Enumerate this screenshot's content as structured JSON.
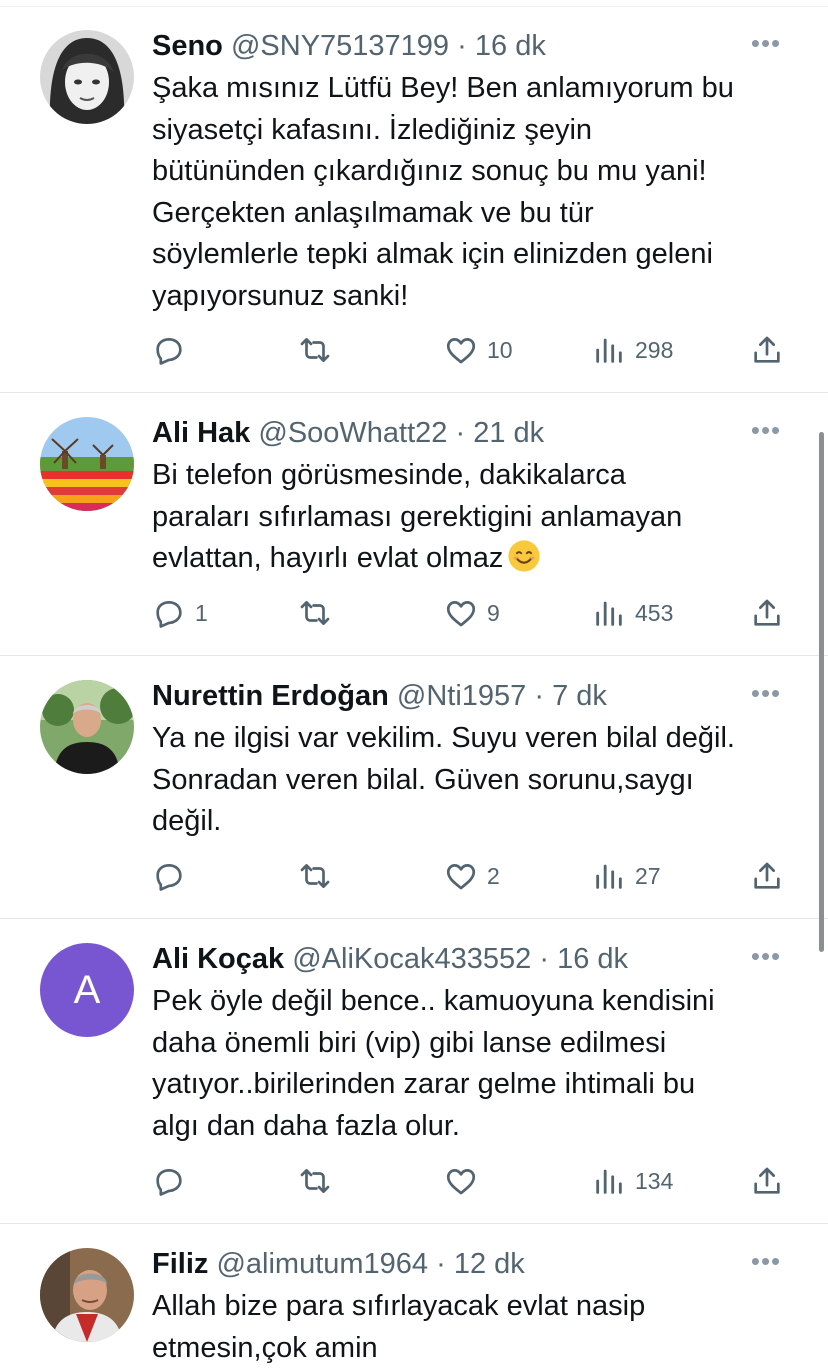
{
  "tweets": [
    {
      "name": "Seno",
      "handle": "@SNY75137199",
      "time": "16 dk",
      "lines": [
        "Şaka mısınız Lütfü Bey! Ben anlamıyorum bu",
        "siyasetçi kafasını. İzlediğiniz şeyin",
        "bütününden çıkardığınız sonuç bu mu yani!",
        "Gerçekten anlaşılmamak ve bu tür",
        "söylemlerle tepki almak için elinizden geleni",
        "yapıyorsunuz sanki!"
      ],
      "replies": "",
      "likes": "10",
      "views": "298"
    },
    {
      "name": "Ali Hak",
      "handle": "@SooWhatt22",
      "time": "21 dk",
      "lines": [
        "Bi telefon görüsmesinde, dakikalarca",
        "paraları sıfırlaması gerektigini anlamayan",
        "evlattan, hayırlı evlat olmaz"
      ],
      "replies": "1",
      "likes": "9",
      "views": "453"
    },
    {
      "name": "Nurettin Erdoğan",
      "handle": "@Nti1957",
      "time": "7 dk",
      "lines": [
        "Ya ne ilgisi var vekilim. Suyu veren bilal değil.",
        "Sonradan veren bilal. Güven sorunu,saygı",
        "değil."
      ],
      "replies": "",
      "likes": "2",
      "views": "27"
    },
    {
      "name": "Ali Koçak",
      "handle": "@AliKocak433552",
      "time": "16 dk",
      "avatar_letter": "A",
      "lines": [
        "Pek öyle değil bence.. kamuoyuna kendisini",
        "daha önemli biri (vip) gibi lanse edilmesi",
        "yatıyor..birilerinden zarar gelme ihtimali bu",
        "algı dan daha fazla olur."
      ],
      "replies": "",
      "likes": "",
      "views": "134"
    },
    {
      "name": "Filiz",
      "handle": "@alimutum1964",
      "time": "12 dk",
      "lines": [
        "Allah bize para sıfırlayacak evlat nasip",
        "etmesin,çok amin"
      ]
    }
  ],
  "separator": "·",
  "colors": {
    "text": "#0f1419",
    "secondary": "#536471",
    "letter_avatar": "#7856d1"
  },
  "icons": [
    "reply-icon",
    "retweet-icon",
    "like-icon",
    "views-icon",
    "share-icon",
    "more-icon",
    "smiling-emoji-icon"
  ]
}
